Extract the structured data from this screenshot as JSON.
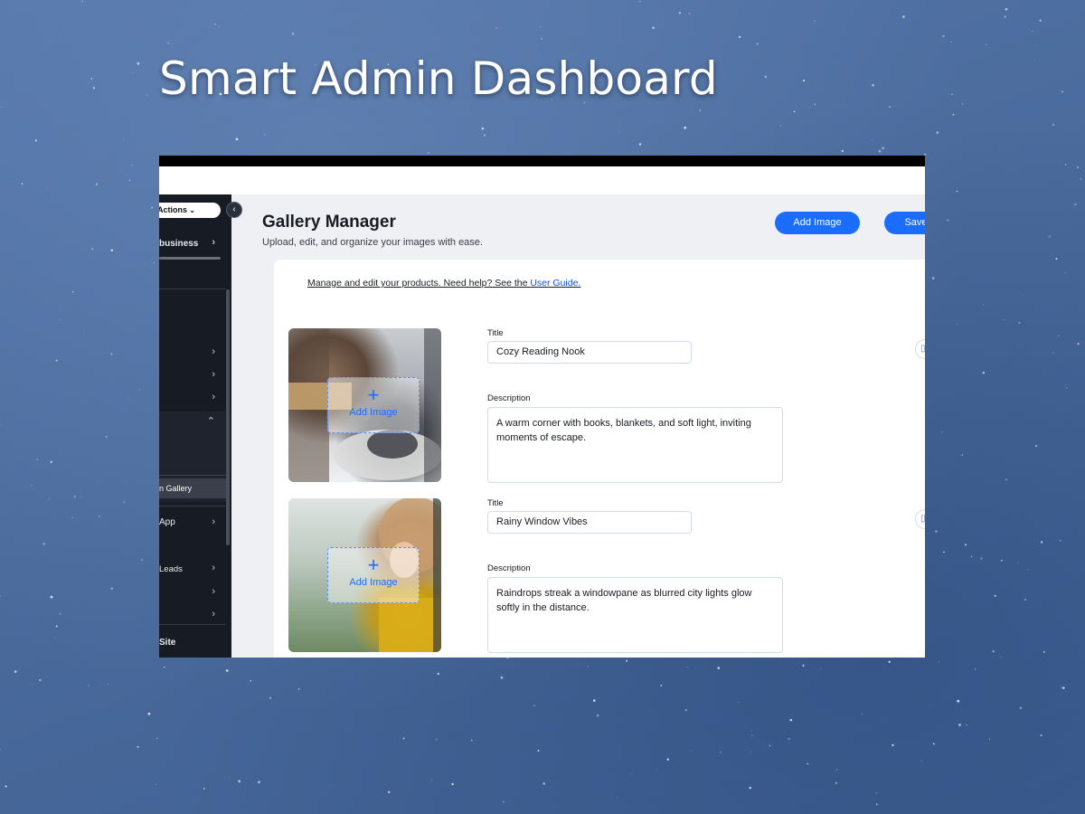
{
  "hero": {
    "title": "Smart Admin Dashboard"
  },
  "sidebar": {
    "actions_label": "Actions",
    "actions_chevron": "⌄",
    "business_label": "business",
    "selected_item": "n Gallery",
    "items": [
      {
        "label": "App"
      },
      {
        "label": "Leads"
      },
      {
        "label": "Site"
      }
    ],
    "chevron": "›",
    "chevron_up": "⌃",
    "collapse_glyph": "‹"
  },
  "header": {
    "title": "Gallery Manager",
    "subtitle": "Upload, edit, and organize your images with ease.",
    "add_image_label": "Add Image",
    "save_label": "Save"
  },
  "help": {
    "text": "Manage and edit your products. Need help? See the ",
    "link_text": "User Guide."
  },
  "labels": {
    "title": "Title",
    "description": "Description",
    "add_image_overlay": "Add Image",
    "plus": "+"
  },
  "items": [
    {
      "title": "Cozy Reading Nook",
      "description": "A warm corner with books, blankets, and soft light, inviting moments of escape."
    },
    {
      "title": "Rainy Window Vibes",
      "description": "Raindrops streak a windowpane as blurred city lights glow softly in the distance."
    }
  ],
  "icons": {
    "edge_icon": "trash-icon"
  }
}
